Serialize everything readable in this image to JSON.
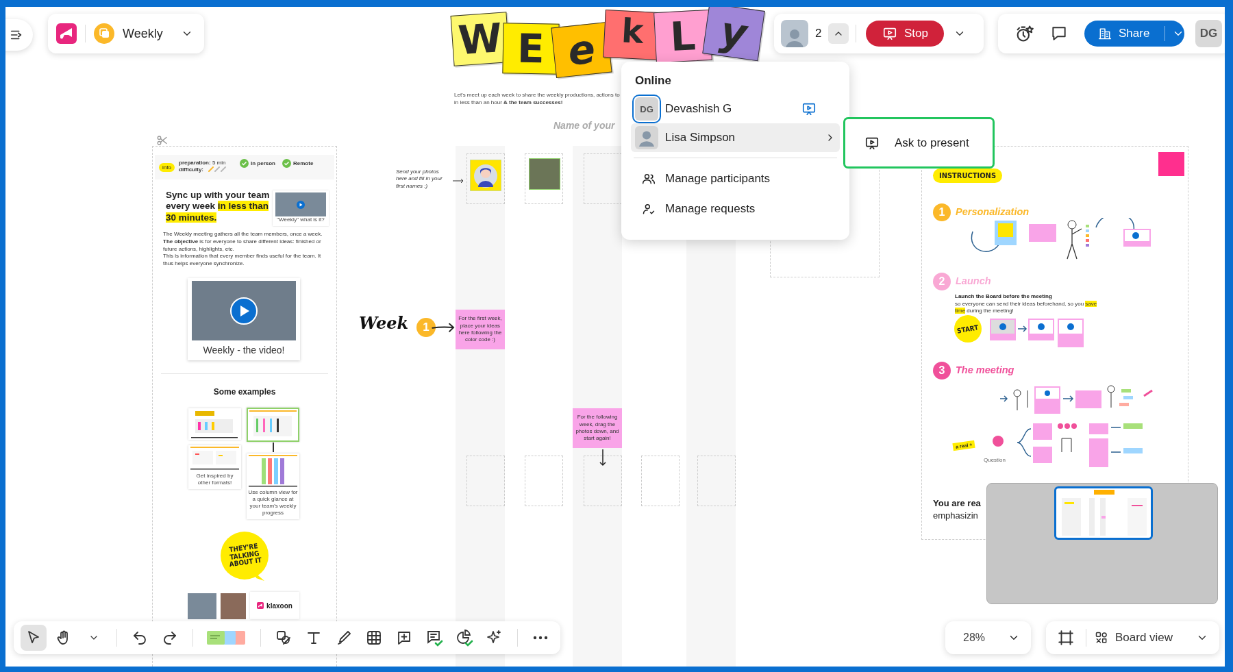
{
  "board": {
    "name": "Weekly"
  },
  "title_letters": [
    {
      "letter": "W",
      "color": "#fdf86e"
    },
    {
      "letter": "E",
      "color": "#ffec00"
    },
    {
      "letter": "e",
      "color": "#ffbf00"
    },
    {
      "letter": "k",
      "color": "#ff6f6f"
    },
    {
      "letter": "L",
      "color": "#ff9fd0"
    },
    {
      "letter": "y",
      "color": "#9f86d8"
    }
  ],
  "intro": {
    "line1": "Let's meet up each week to share the weekly productions, actions to",
    "line2": "in less than an hour **& the team successes!**"
  },
  "column_header": "Name of your",
  "participants": {
    "count": "2",
    "stop_label": "Stop"
  },
  "share_label": "Share",
  "user_initials": "DG",
  "online_menu": {
    "heading": "Online",
    "people": [
      {
        "initials": "DG",
        "name": "Devashish G",
        "presenting": true,
        "selected": false
      },
      {
        "name": "Lisa Simpson",
        "presenting": false,
        "selected": true
      }
    ],
    "actions": [
      {
        "kind": "participants",
        "label": "Manage participants"
      },
      {
        "kind": "requests",
        "label": "Manage requests"
      }
    ]
  },
  "submenu": {
    "label": "Ask to present"
  },
  "info_panel": {
    "tag": "info",
    "preparation": "**preparation:** 5 min",
    "difficulty": "difficulty:",
    "modes": [
      "In person",
      "Remote"
    ],
    "heading": {
      "text": "Sync up with your team every week ",
      "highlight": "in less than 30 minutes."
    },
    "thumb_caption": "\"Weekly\" what is it?",
    "paragraphs": [
      "The Weekly meeting gathers all the team members, once a week. **The objective** is for everyone to share different ideas: finished or future actions, highlights, etc.",
      "This is information that every member finds useful for the team. It thus helps everyone synchronize."
    ],
    "video_caption": "Weekly - the video!",
    "examples_title": "Some examples",
    "example_captions": [
      "Get inspired by other formats!",
      "Use column view for a quick glance at your team's weekly progress"
    ],
    "bubble": "THEY'RE TALKING ABOUT IT",
    "logo": "klaxoon"
  },
  "photo_note": "Send your photos here and fill in your first names :)",
  "week": {
    "label": "Week",
    "number": "1"
  },
  "sticky_notes": [
    "For the first week, place your ideas here following the color code :)",
    "For the following week, drag the photos down, and start again!"
  ],
  "instructions": {
    "tag": "INSTRUCTIONS",
    "steps": [
      {
        "number": "1",
        "title": "Personalization",
        "color": "#fbb829"
      },
      {
        "number": "2",
        "title": "Launch",
        "color": "#f9a8d4"
      },
      {
        "number": "3",
        "title": "The meeting",
        "color": "#f0509a"
      }
    ],
    "launch_title": "Launch the Board before the meeting",
    "launch_text": {
      "before": "so everyone can send their ideas beforehand, so you ",
      "highlight": "save time",
      "after": " during the meeting!"
    },
    "start": "START",
    "real_plus": "a real +",
    "question": "Question",
    "closing": [
      "You are rea",
      "emphasizin"
    ]
  },
  "toolbar": {
    "groups": [
      [
        {
          "kind": "select",
          "selected": true
        },
        {
          "kind": "hand",
          "selected": false
        },
        {
          "kind": "caret",
          "selected": false
        }
      ],
      [
        {
          "kind": "undo",
          "selected": false
        },
        {
          "kind": "redo",
          "selected": false
        }
      ],
      [
        {
          "kind": "stickies",
          "selected": false
        }
      ],
      [
        {
          "kind": "shapes",
          "selected": false
        },
        {
          "kind": "text",
          "selected": false
        },
        {
          "kind": "pen",
          "selected": false
        },
        {
          "kind": "table",
          "selected": false
        },
        {
          "kind": "comment",
          "selected": false
        },
        {
          "kind": "form",
          "selected": false
        },
        {
          "kind": "chart",
          "selected": false
        },
        {
          "kind": "sparkle",
          "selected": false
        }
      ],
      [
        {
          "kind": "more",
          "selected": false
        }
      ]
    ]
  },
  "zoom": "28%",
  "view": "Board view"
}
